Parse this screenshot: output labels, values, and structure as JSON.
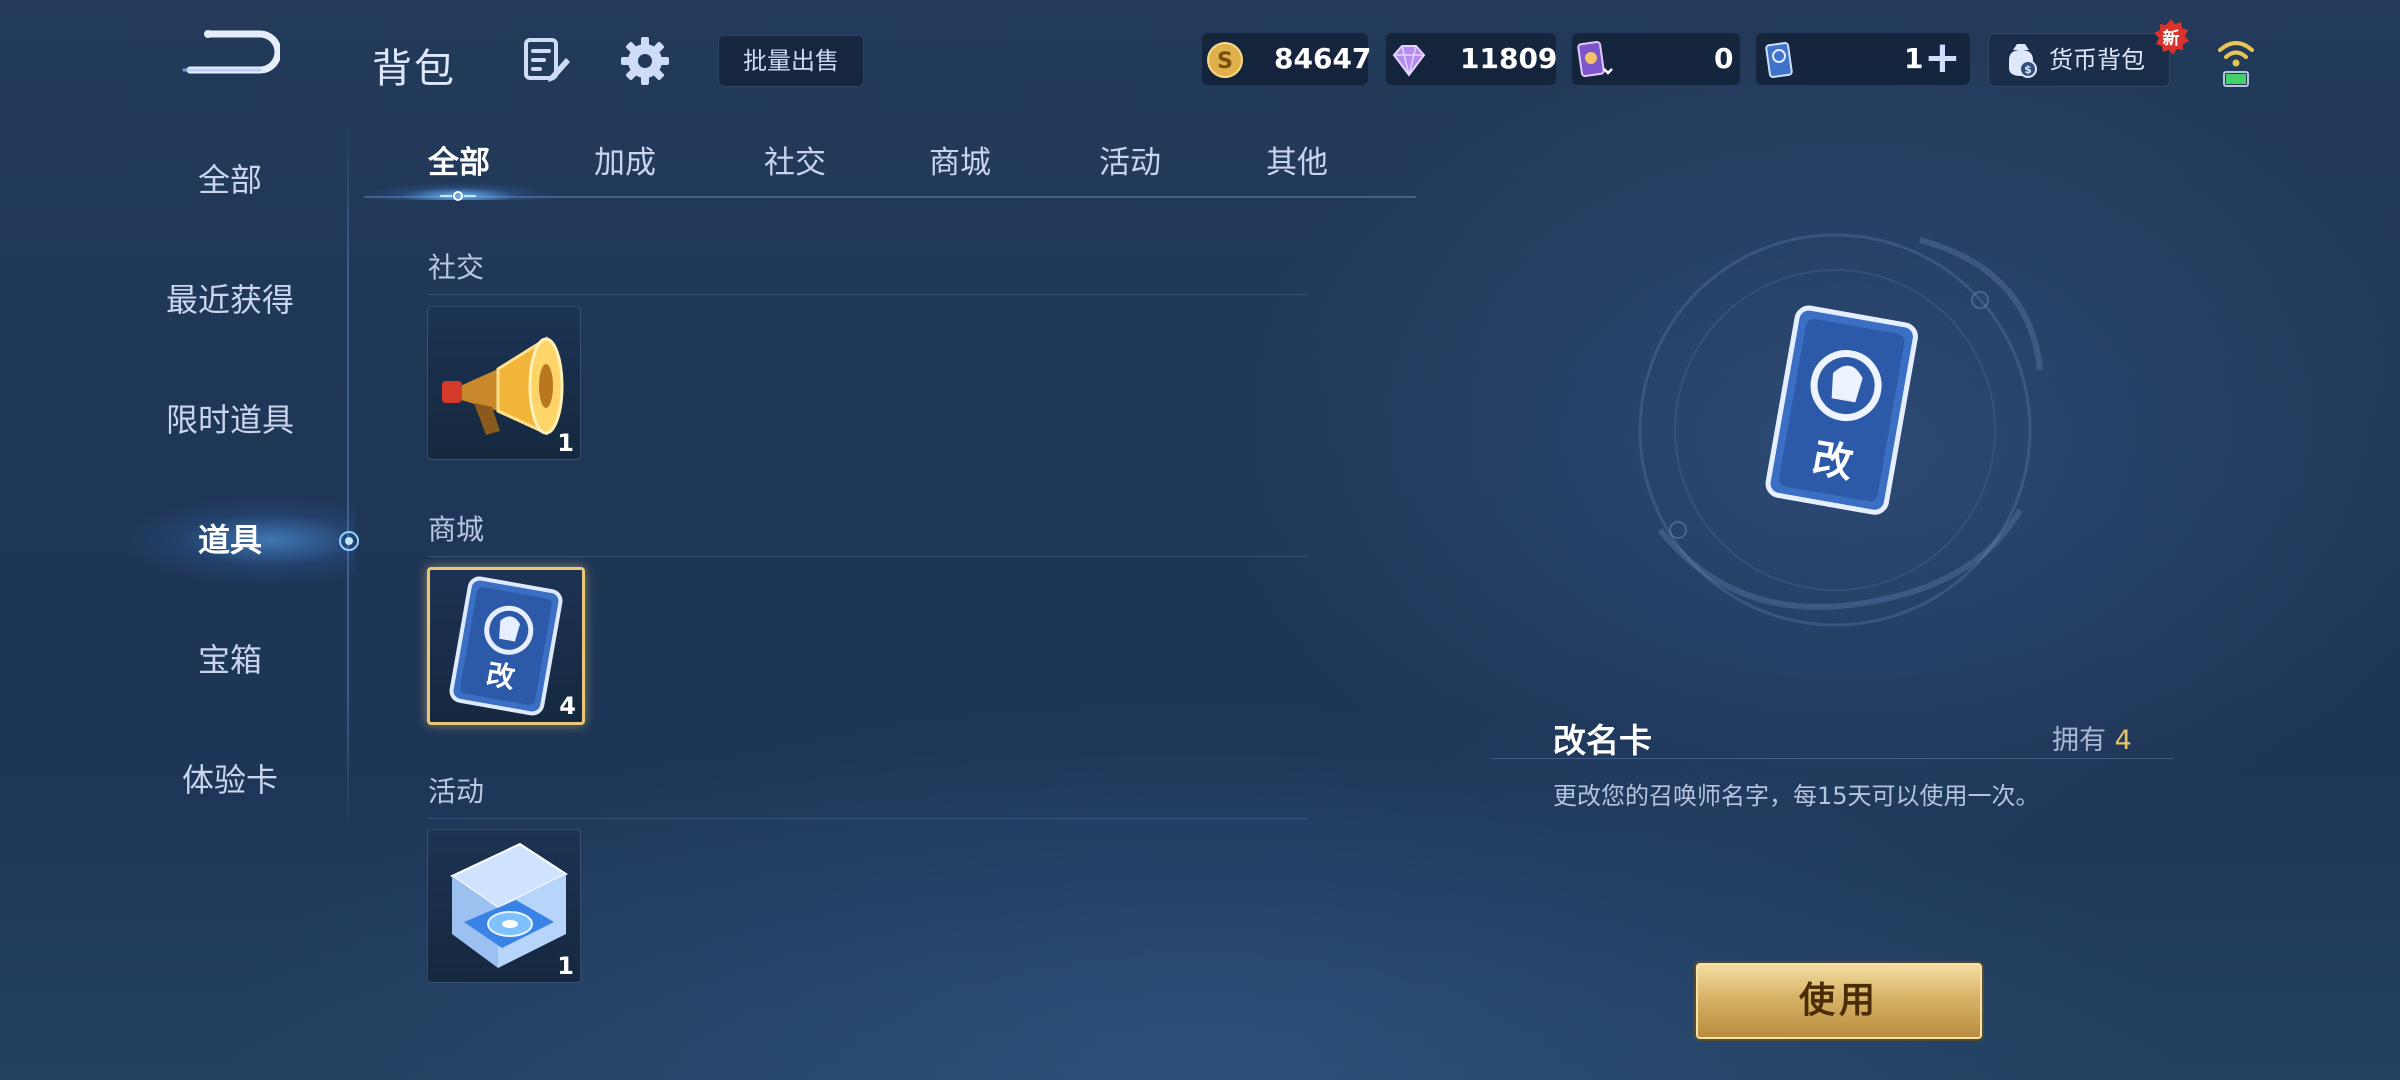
{
  "header": {
    "title": "背包",
    "bulk_sell_label": "批量出售"
  },
  "currencies": {
    "gold": "84647",
    "diamond": "11809",
    "purple_card": "0",
    "blue_card": "1",
    "blue_card_plus": "+"
  },
  "wallet": {
    "label": "货币背包",
    "badge": "新"
  },
  "sidebar": {
    "items": [
      {
        "label": "全部"
      },
      {
        "label": "最近获得"
      },
      {
        "label": "限时道具"
      },
      {
        "label": "道具"
      },
      {
        "label": "宝箱"
      },
      {
        "label": "体验卡"
      }
    ],
    "active": "道具"
  },
  "tabs": [
    {
      "label": "全部"
    },
    {
      "label": "加成"
    },
    {
      "label": "社交"
    },
    {
      "label": "商城"
    },
    {
      "label": "活动"
    },
    {
      "label": "其他"
    }
  ],
  "sections": [
    {
      "label": "社交",
      "items": [
        {
          "icon": "megaphone-icon",
          "count": "1"
        }
      ]
    },
    {
      "label": "商城",
      "items": [
        {
          "icon": "rename-card-icon",
          "count": "4"
        }
      ]
    },
    {
      "label": "活动",
      "items": [
        {
          "icon": "gift-box-icon",
          "count": "1"
        }
      ]
    }
  ],
  "detail": {
    "name": "改名卡",
    "owned_label": "拥有",
    "owned_count": "4",
    "description": "更改您的召唤师名字，每15天可以使用一次。",
    "card_glyph": "改"
  },
  "actions": {
    "use_label": "使用"
  },
  "colors": {
    "accent_gold": "#e6c26a",
    "button_gold": "#d8b367",
    "background": "#1f3757"
  }
}
